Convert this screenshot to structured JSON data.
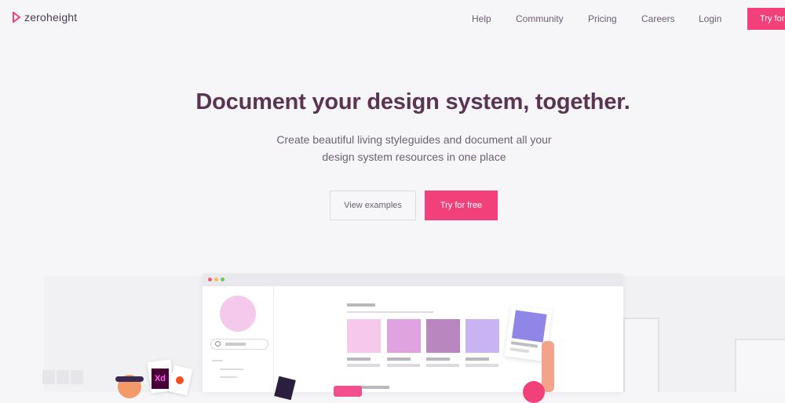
{
  "header": {
    "logo_text": "zeroheight",
    "nav": [
      {
        "label": "Help"
      },
      {
        "label": "Community"
      },
      {
        "label": "Pricing"
      },
      {
        "label": "Careers"
      },
      {
        "label": "Login"
      }
    ],
    "cta_label": "Try for free"
  },
  "hero": {
    "title": "Document your design system, together.",
    "subtitle_line1": "Create beautiful living styleguides and document all your",
    "subtitle_line2": "design system resources in one place",
    "secondary_button": "View examples",
    "primary_button": "Try for free"
  },
  "illustration": {
    "swatches": [
      "#f6c8ec",
      "#dea3e0",
      "#b986bf",
      "#c8b4f3"
    ],
    "window_dots": [
      "#f0606a",
      "#f6be4f",
      "#6cc467"
    ],
    "card_image_color": "#8f86e8",
    "app_badge": "Xd"
  },
  "colors": {
    "brand_pink": "#f2417a",
    "title_plum": "#5b3452",
    "background": "#f6f6f9"
  }
}
